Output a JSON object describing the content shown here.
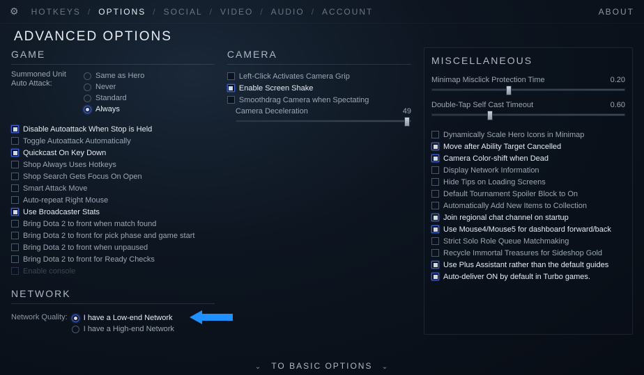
{
  "header": {
    "tabs": [
      "HOTKEYS",
      "OPTIONS",
      "SOCIAL",
      "VIDEO",
      "AUDIO",
      "ACCOUNT"
    ],
    "active_index": 1,
    "about": "ABOUT"
  },
  "page_title": "ADVANCED OPTIONS",
  "game": {
    "title": "GAME",
    "summoned_label": "Summoned Unit Auto Attack:",
    "summoned_options": [
      "Same as Hero",
      "Never",
      "Standard",
      "Always"
    ],
    "summoned_selected_index": 3,
    "checks": [
      {
        "label": "Disable Autoattack When Stop is Held",
        "checked": true
      },
      {
        "label": "Toggle Autoattack Automatically",
        "checked": false
      },
      {
        "label": "Quickcast On Key Down",
        "checked": true
      },
      {
        "label": "Shop Always Uses Hotkeys",
        "checked": false
      },
      {
        "label": "Shop Search Gets Focus On Open",
        "checked": false
      },
      {
        "label": "Smart Attack Move",
        "checked": false
      },
      {
        "label": "Auto-repeat Right Mouse",
        "checked": false
      },
      {
        "label": "Use Broadcaster Stats",
        "checked": true
      },
      {
        "label": "Bring Dota 2 to front when match found",
        "checked": false
      },
      {
        "label": "Bring Dota 2 to front for pick phase and game start",
        "checked": false
      },
      {
        "label": "Bring Dota 2 to front when unpaused",
        "checked": false
      },
      {
        "label": "Bring Dota 2 to front for Ready Checks",
        "checked": false
      },
      {
        "label": "Enable console",
        "checked": false,
        "disabled": true
      }
    ]
  },
  "camera": {
    "title": "CAMERA",
    "checks": [
      {
        "label": "Left-Click Activates Camera Grip",
        "checked": false
      },
      {
        "label": "Enable Screen Shake",
        "checked": true
      },
      {
        "label": "Smoothdrag Camera when Spectating",
        "checked": false
      }
    ],
    "decel_label": "Camera Deceleration",
    "decel_value": "49",
    "decel_percent": 98
  },
  "network": {
    "title": "NETWORK",
    "quality_label": "Network Quality:",
    "options": [
      "I have a Low-end Network",
      "I have a High-end Network"
    ],
    "selected_index": 0
  },
  "misc": {
    "title": "MISCELLANEOUS",
    "sliders": [
      {
        "label": "Minimap Misclick Protection Time",
        "value": "0.20",
        "percent": 40
      },
      {
        "label": "Double-Tap Self Cast Timeout",
        "value": "0.60",
        "percent": 30
      }
    ],
    "checks": [
      {
        "label": "Dynamically Scale Hero Icons in Minimap",
        "checked": false
      },
      {
        "label": "Move after Ability Target Cancelled",
        "checked": true
      },
      {
        "label": "Camera Color-shift when Dead",
        "checked": true
      },
      {
        "label": "Display Network Information",
        "checked": false
      },
      {
        "label": "Hide Tips on Loading Screens",
        "checked": false
      },
      {
        "label": "Default Tournament Spoiler Block to On",
        "checked": false
      },
      {
        "label": "Automatically Add New Items to Collection",
        "checked": false
      },
      {
        "label": "Join regional chat channel on startup",
        "checked": true
      },
      {
        "label": "Use Mouse4/Mouse5 for dashboard forward/back",
        "checked": true
      },
      {
        "label": "Strict Solo Role Queue Matchmaking",
        "checked": false
      },
      {
        "label": "Recycle Immortal Treasures for Sideshop Gold",
        "checked": false
      },
      {
        "label": "Use Plus Assistant rather than the default guides",
        "checked": true
      },
      {
        "label": "Auto-deliver ON by default in Turbo games.",
        "checked": true
      }
    ]
  },
  "footer_label": "TO BASIC OPTIONS"
}
